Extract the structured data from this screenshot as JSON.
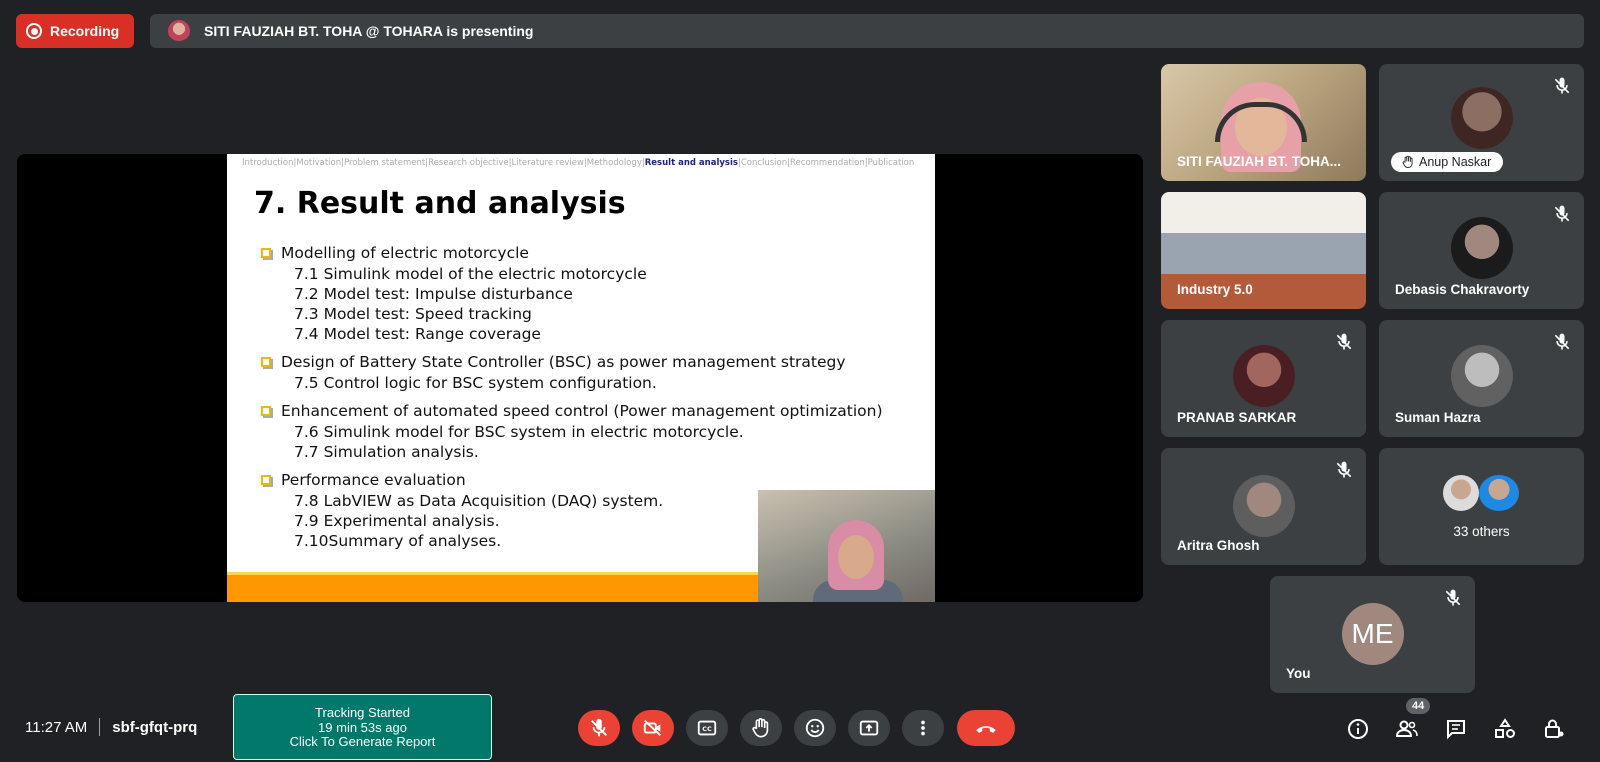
{
  "recording": {
    "label": "Recording"
  },
  "presenting_bar": {
    "text": "SITI FAUZIAH BT. TOHA @ TOHARA is presenting"
  },
  "slide": {
    "nav_items": [
      "Introduction",
      "Motivation",
      "Problem statement",
      "Research objective",
      "Literature review",
      "Methodology",
      "Result and analysis",
      "Conclusion",
      "Recommendation",
      "Publication"
    ],
    "nav_active_index": 6,
    "title": "7. Result and analysis",
    "sections": [
      {
        "heading": "Modelling of electric motorcycle",
        "items": [
          "7.1  Simulink model of the electric motorcycle",
          "7.2  Model test: Impulse disturbance",
          "7.3  Model test: Speed tracking",
          "7.4  Model test: Range coverage"
        ]
      },
      {
        "heading": "Design of Battery State Controller (BSC) as power management strategy",
        "items": [
          "7.5  Control logic for BSC system configuration."
        ]
      },
      {
        "heading": "Enhancement of automated speed control (Power management optimization)",
        "items": [
          "7.6  Simulink model for BSC system in electric motorcycle.",
          "7.7  Simulation analysis."
        ]
      },
      {
        "heading": "Performance evaluation",
        "items": [
          "7.8  LabVIEW as Data Acquisition (DAQ) system.",
          "7.9  Experimental analysis.",
          "7.10Summary of analyses."
        ]
      }
    ]
  },
  "tiles": {
    "presenter": "SITI FAUZIAH BT. TOHA...",
    "anup": "Anup Naskar",
    "industry": "Industry 5.0",
    "debasis": "Debasis Chakravorty",
    "pranab": "PRANAB SARKAR",
    "suman": "Suman Hazra",
    "aritra": "Aritra Ghosh",
    "others": "33 others",
    "you": "You",
    "you_initials": "ME"
  },
  "bottom": {
    "time": "11:27 AM",
    "meeting_code": "sbf-gfqt-prq",
    "tracking_line1": "Tracking Started",
    "tracking_line2": "19 min 53s ago",
    "tracking_line3": "Click To Generate Report",
    "people_count": "44"
  },
  "colors": {
    "accent_red": "#ea4335",
    "tracking_green": "#00796b",
    "tile_bg": "#3c4043",
    "page_bg": "#202124"
  }
}
